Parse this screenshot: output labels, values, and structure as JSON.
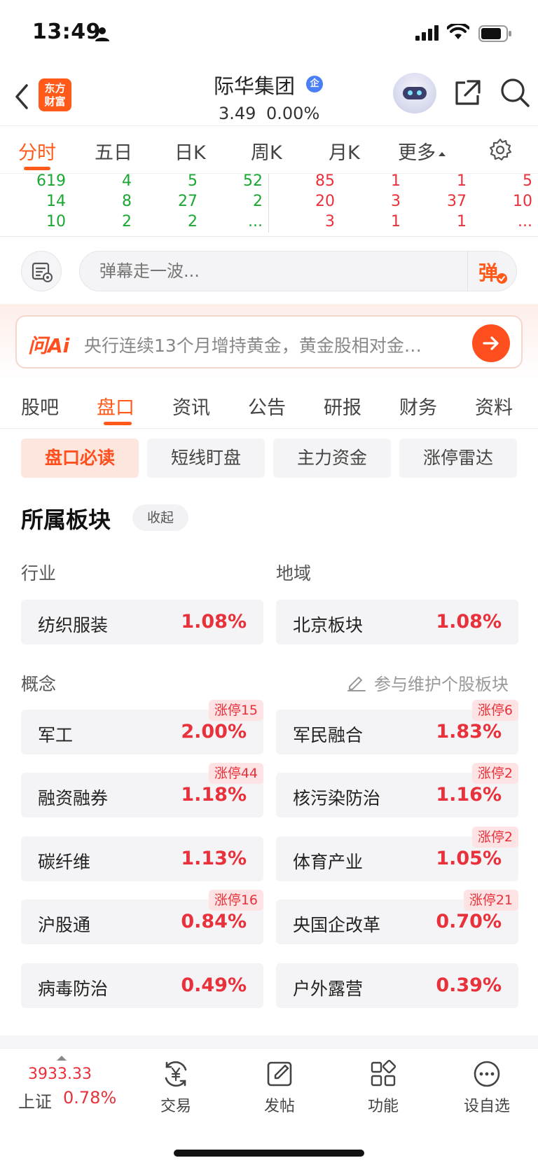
{
  "status_bar": {
    "time": "13:49"
  },
  "header": {
    "logo_line1": "东方",
    "logo_line2": "财富",
    "stock_name": "际华集团",
    "verify_badge": "企",
    "price": "3.49",
    "change": "0.00%"
  },
  "chart_tabs": [
    "分时",
    "五日",
    "日K",
    "周K",
    "月K",
    "更多"
  ],
  "orderbook": {
    "rows": [
      {
        "buy": [
          "619",
          "4",
          "5",
          "52"
        ],
        "sell": [
          "85",
          "1",
          "1",
          "5"
        ]
      },
      {
        "buy": [
          "14",
          "8",
          "27",
          "2"
        ],
        "sell": [
          "20",
          "3",
          "37",
          "10"
        ]
      },
      {
        "buy": [
          "10",
          "2",
          "2",
          "..."
        ],
        "sell": [
          "3",
          "1",
          "1",
          "..."
        ]
      }
    ]
  },
  "barrage": {
    "placeholder": "弹幕走一波...",
    "send_label": "弹"
  },
  "ai_banner": {
    "logo": "问Ai",
    "text": "央行连续13个月增持黄金，黄金股相对金…"
  },
  "content_tabs": [
    "股吧",
    "盘口",
    "资讯",
    "公告",
    "研报",
    "财务",
    "资料"
  ],
  "sub_tabs": [
    "盘口必读",
    "短线盯盘",
    "主力资金",
    "涨停雷达"
  ],
  "sectors": {
    "title": "所属板块",
    "collapse_label": "收起",
    "industry_label": "行业",
    "region_label": "地域",
    "concept_label": "概念",
    "edit_link": "参与维护个股板块",
    "industry": {
      "name": "纺织服装",
      "pct": "1.08%"
    },
    "region": {
      "name": "北京板块",
      "pct": "1.08%"
    },
    "concepts": [
      {
        "name": "军工",
        "pct": "2.00%",
        "badge": "涨停15"
      },
      {
        "name": "军民融合",
        "pct": "1.83%",
        "badge": "涨停6"
      },
      {
        "name": "融资融券",
        "pct": "1.18%",
        "badge": "涨停44"
      },
      {
        "name": "核污染防治",
        "pct": "1.16%",
        "badge": "涨停2"
      },
      {
        "name": "碳纤维",
        "pct": "1.13%",
        "badge": ""
      },
      {
        "name": "体育产业",
        "pct": "1.05%",
        "badge": "涨停2"
      },
      {
        "name": "沪股通",
        "pct": "0.84%",
        "badge": "涨停16"
      },
      {
        "name": "央国企改革",
        "pct": "0.70%",
        "badge": "涨停21"
      },
      {
        "name": "病毒防治",
        "pct": "0.49%",
        "badge": ""
      },
      {
        "name": "户外露营",
        "pct": "0.39%",
        "badge": ""
      }
    ]
  },
  "bottom_nav": {
    "index_value": "3933.33",
    "index_name": "上证",
    "index_pct": "0.78%",
    "items": [
      "交易",
      "发帖",
      "功能",
      "设自选"
    ]
  },
  "colors": {
    "accent": "#ff5a1a",
    "up": "#e8313b",
    "down": "#1aa832"
  }
}
